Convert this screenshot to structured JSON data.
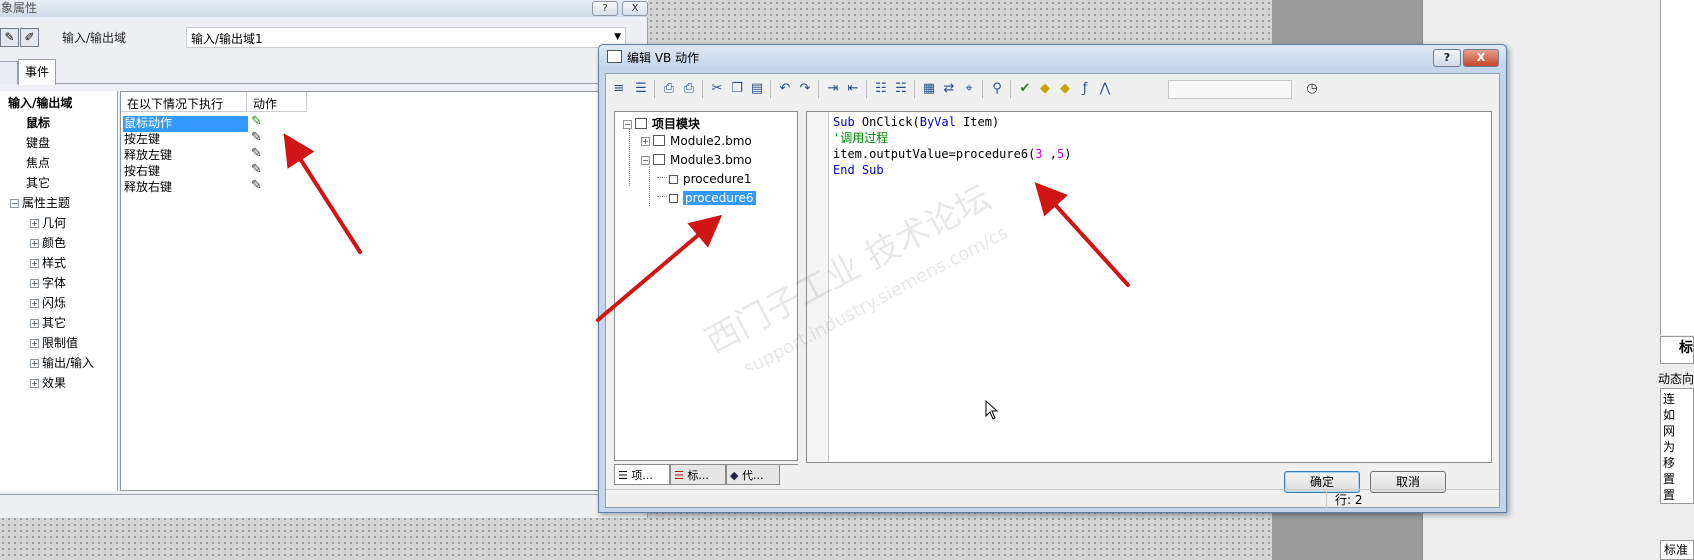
{
  "prop_window": {
    "title": "象属性",
    "title_help": "?",
    "title_close": "X",
    "object_type": "输入/输出域",
    "object_name": "输入/输出域1",
    "tabs": [
      {
        "label": ""
      },
      {
        "label": "事件"
      }
    ],
    "tree": {
      "root": "输入/输出域",
      "items": [
        "鼠标",
        "键盘",
        "焦点",
        "其它"
      ],
      "theme": "属性主题",
      "theme_items": [
        "几何",
        "颜色",
        "样式",
        "字体",
        "闪烁",
        "其它",
        "限制值",
        "输出/输入",
        "效果"
      ]
    },
    "grid": {
      "headers": [
        "在以下情况下执行",
        "动作"
      ],
      "rows": [
        "鼠标动作",
        "按左键",
        "释放左键",
        "按右键",
        "释放右键"
      ]
    }
  },
  "vb_dialog": {
    "title": "编辑 VB 动作",
    "help_label": "?",
    "close_label": "X",
    "tree": {
      "root": "项目模块",
      "modules": [
        "Module2.bmo",
        "Module3.bmo"
      ],
      "procedures": [
        "procedure1",
        "procedure6"
      ]
    },
    "tabs": [
      "项...",
      "标...",
      "代..."
    ],
    "code": {
      "line1_kw": "Sub",
      "line1_name": " OnClick(",
      "line1_kw2": "ByVal",
      "line1_rest": " Item)",
      "line2_comment": "'调用过程",
      "line3_a": "item.outputValue=procedure6(",
      "line3_n1": "3",
      "line3_b": " ,",
      "line3_n2": "5",
      "line3_c": ")",
      "line4": "End Sub"
    },
    "ok_label": "确定",
    "cancel_label": "取消",
    "status": "行: 2"
  },
  "right_panel": {
    "tab_label": "标",
    "section_title": "动态向",
    "list": [
      "连",
      "如",
      "网",
      "为",
      "移",
      "置",
      "置"
    ],
    "bottom": "标准"
  },
  "watermark": {
    "line1": "西门子工业  技术论坛",
    "line2": "support.industry.siemens.com/cs"
  },
  "colors": {
    "selection": "#3399ff",
    "arrow": "#d11414",
    "keyword": "#0000cc",
    "comment": "#008800",
    "number": "#cc00cc"
  }
}
